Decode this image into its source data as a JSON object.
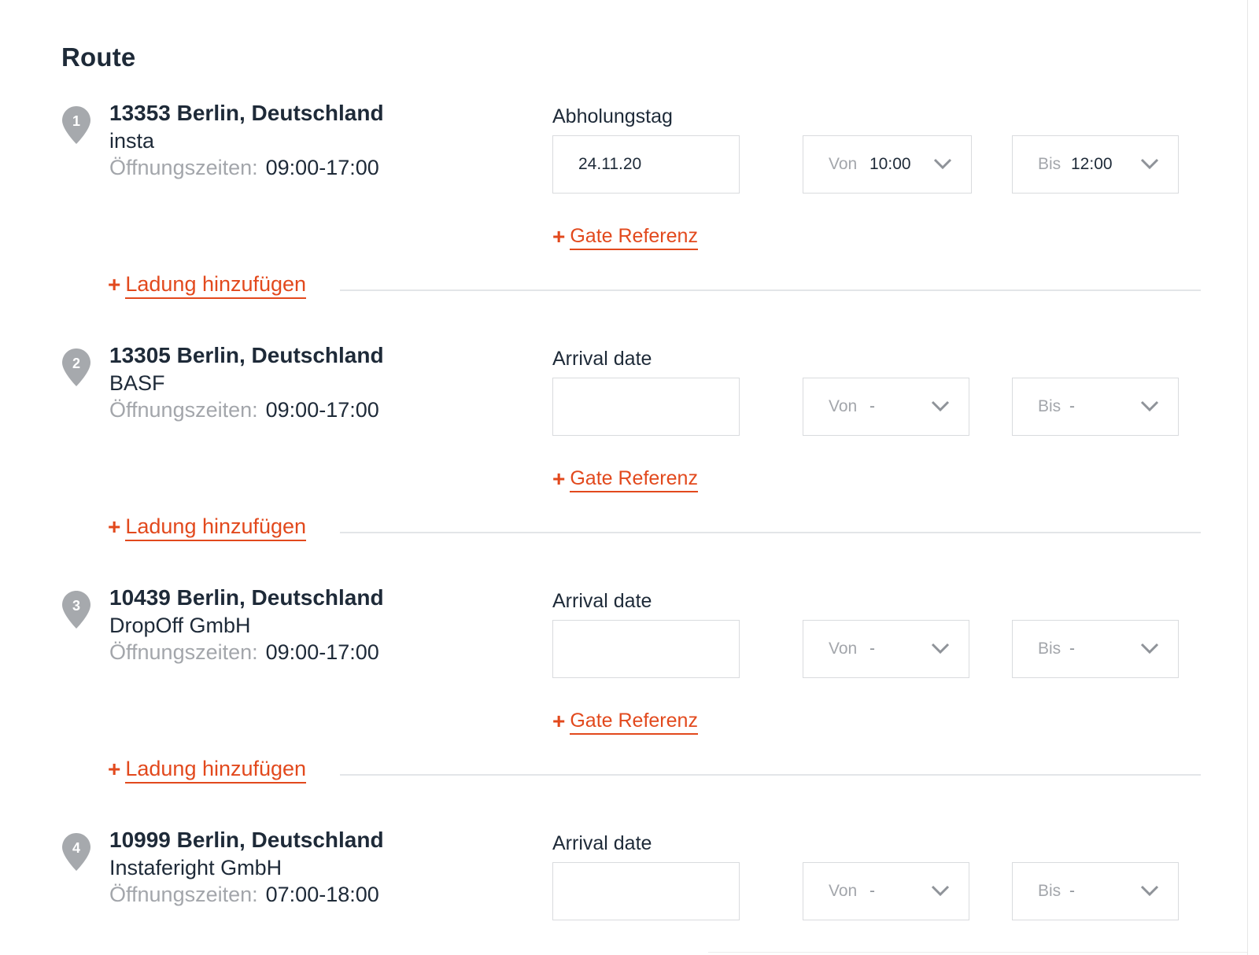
{
  "title": "Route",
  "hours_label": "Öffnungszeiten:",
  "gate_label": "Gate Referenz",
  "load_label": "Ladung hinzufügen",
  "von_prefix": "Von",
  "bis_prefix": "Bis",
  "colors": {
    "accent": "#e2491d",
    "text": "#1e2a38",
    "muted": "#a3a6ab",
    "pin": "#a6a9ad",
    "border": "#d9dbde"
  },
  "icons": {
    "pin": "map-pin-icon",
    "chevron": "chevron-down-icon",
    "plus": "plus-icon"
  },
  "stops": [
    {
      "number": "1",
      "address": "13353 Berlin, Deutschland",
      "company": "insta",
      "hours": "09:00-17:00",
      "date_label": "Abholungstag",
      "date_value": "24.11.20",
      "von_value": "10:00",
      "bis_value": "12:00"
    },
    {
      "number": "2",
      "address": "13305 Berlin, Deutschland",
      "company": "BASF",
      "hours": "09:00-17:00",
      "date_label": "Arrival date",
      "date_value": "",
      "von_value": "-",
      "bis_value": "-"
    },
    {
      "number": "3",
      "address": "10439 Berlin, Deutschland",
      "company": "DropOff GmbH",
      "hours": "09:00-17:00",
      "date_label": "Arrival date",
      "date_value": "",
      "von_value": "-",
      "bis_value": "-"
    },
    {
      "number": "4",
      "address": "10999 Berlin, Deutschland",
      "company": "Instaferight GmbH",
      "hours": "07:00-18:00",
      "date_label": "Arrival date",
      "date_value": "",
      "von_value": "-",
      "bis_value": "-"
    }
  ]
}
